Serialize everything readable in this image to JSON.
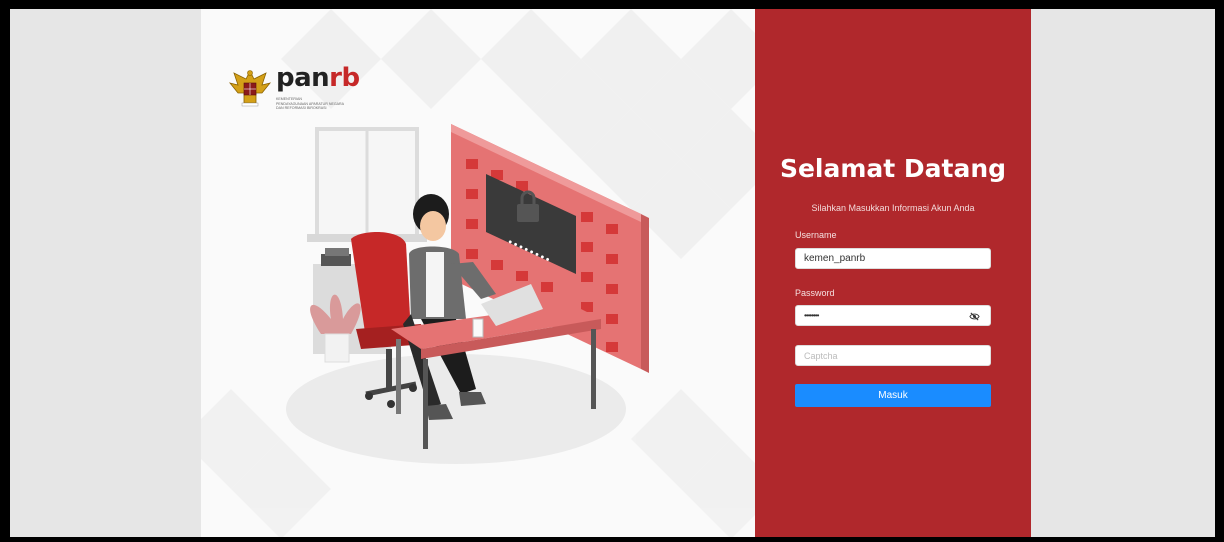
{
  "brand": {
    "name_dark": "pan",
    "name_red": "rb",
    "subtitle_lines": [
      "KEMENTERIAN",
      "PENDAYAGUNAAN APARATUR NEGARA",
      "DAN REFORMASI BIROKRASI"
    ]
  },
  "login": {
    "title": "Selamat Datang",
    "subtitle": "Silahkan Masukkan Informasi Akun Anda",
    "username_label": "Username",
    "username_value": "kemen_panrb",
    "password_label": "Password",
    "password_value": "••••••••",
    "captcha_placeholder": "Captcha",
    "submit_label": "Masuk"
  },
  "colors": {
    "panel": "#b0282c",
    "button": "#1a8cff",
    "illustration_red": "#e57373"
  },
  "icons": [
    "garuda-emblem-icon",
    "eye-off-icon"
  ]
}
